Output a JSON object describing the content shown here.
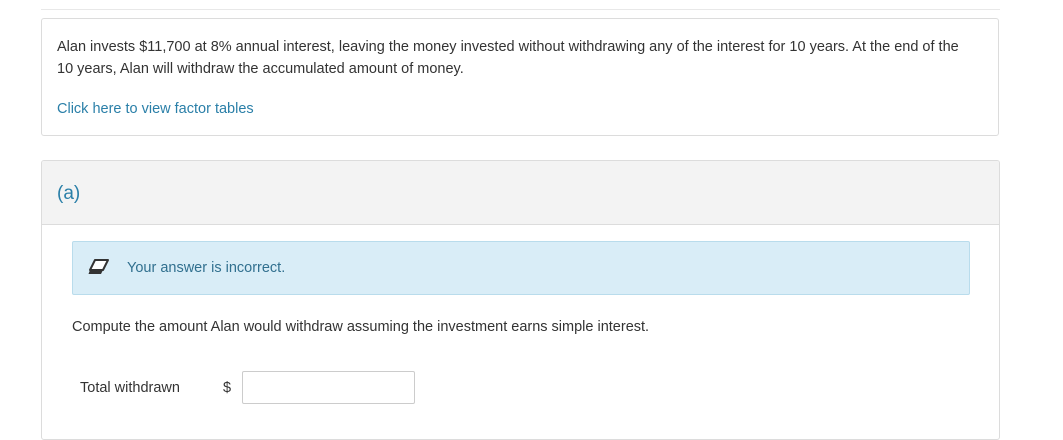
{
  "question": {
    "text": "Alan invests $11,700 at 8% annual interest, leaving the money invested without withdrawing any of the interest for 10 years. At the end of the 10 years, Alan will withdraw the accumulated amount of money.",
    "factor_link": "Click here to view factor tables"
  },
  "part": {
    "label": "(a)",
    "alert": {
      "icon": "eraser-icon",
      "text": "Your answer is incorrect.",
      "color": "#31708f",
      "background": "#d9edf7"
    },
    "prompt": "Compute the amount Alan would withdraw assuming the investment earns simple interest.",
    "answer": {
      "label": "Total withdrawn",
      "currency_symbol": "$",
      "value": ""
    }
  },
  "colors": {
    "link": "#2a7fa8",
    "text": "#333333",
    "header_bg": "#f3f3f3"
  }
}
